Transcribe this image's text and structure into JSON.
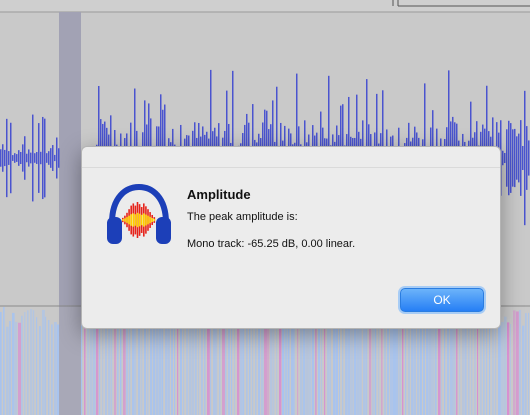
{
  "background": {
    "track_bg": "#c9c9c9",
    "waveform_color": "#4a54cf",
    "spectrogram_light": "#a7c3ef",
    "spectrogram_pink": "#d88fd0",
    "selection_color": "#a2a2b4"
  },
  "dialog": {
    "title": "Amplitude",
    "line1": "The peak amplitude is:",
    "line2": "Mono track: -65.25 dB, 0.00 linear.",
    "ok_label": "OK",
    "icon": "audacity-logo-icon"
  }
}
